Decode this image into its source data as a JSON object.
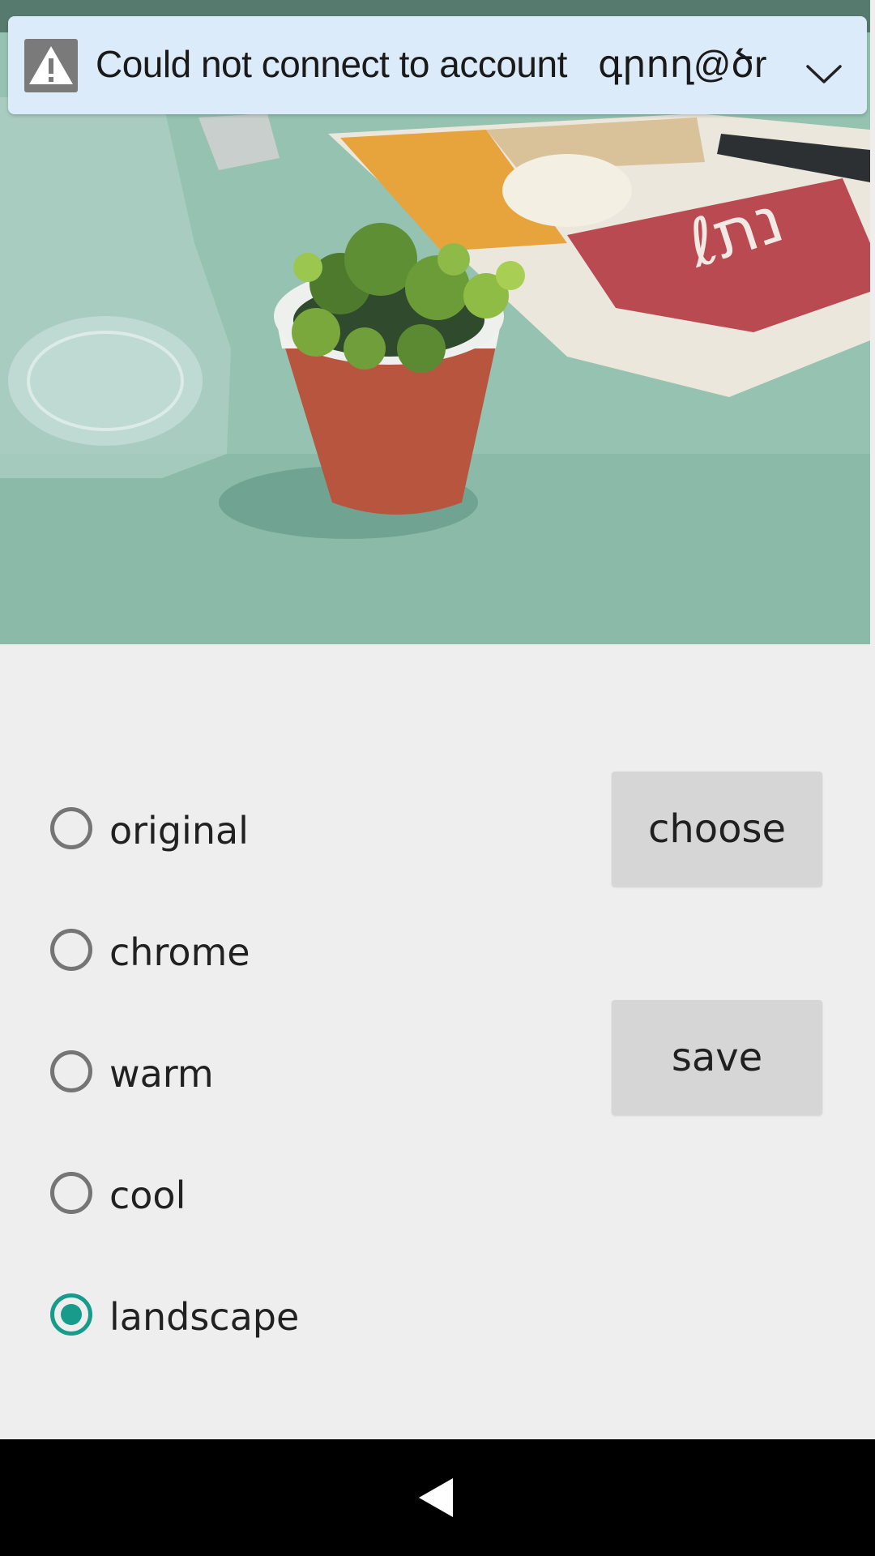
{
  "banner": {
    "message": "Could not connect to account",
    "account": "գրող@ծr",
    "icon": "warning-icon",
    "expand_icon": "chevron-down-icon"
  },
  "photo": {
    "subject": "photo-preview"
  },
  "filters": {
    "options": [
      {
        "label": "original",
        "checked": false
      },
      {
        "label": "chrome",
        "checked": false
      },
      {
        "label": "warm",
        "checked": false
      },
      {
        "label": "cool",
        "checked": false
      },
      {
        "label": "landscape",
        "checked": true
      }
    ]
  },
  "buttons": {
    "choose_label": "choose",
    "save_label": "save"
  },
  "navbar": {
    "back_icon": "back-triangle-icon"
  },
  "colors": {
    "accent": "#179c8c",
    "banner_bg": "#dcebf9",
    "background": "#eeeeee",
    "button_bg": "#d6d6d6"
  }
}
